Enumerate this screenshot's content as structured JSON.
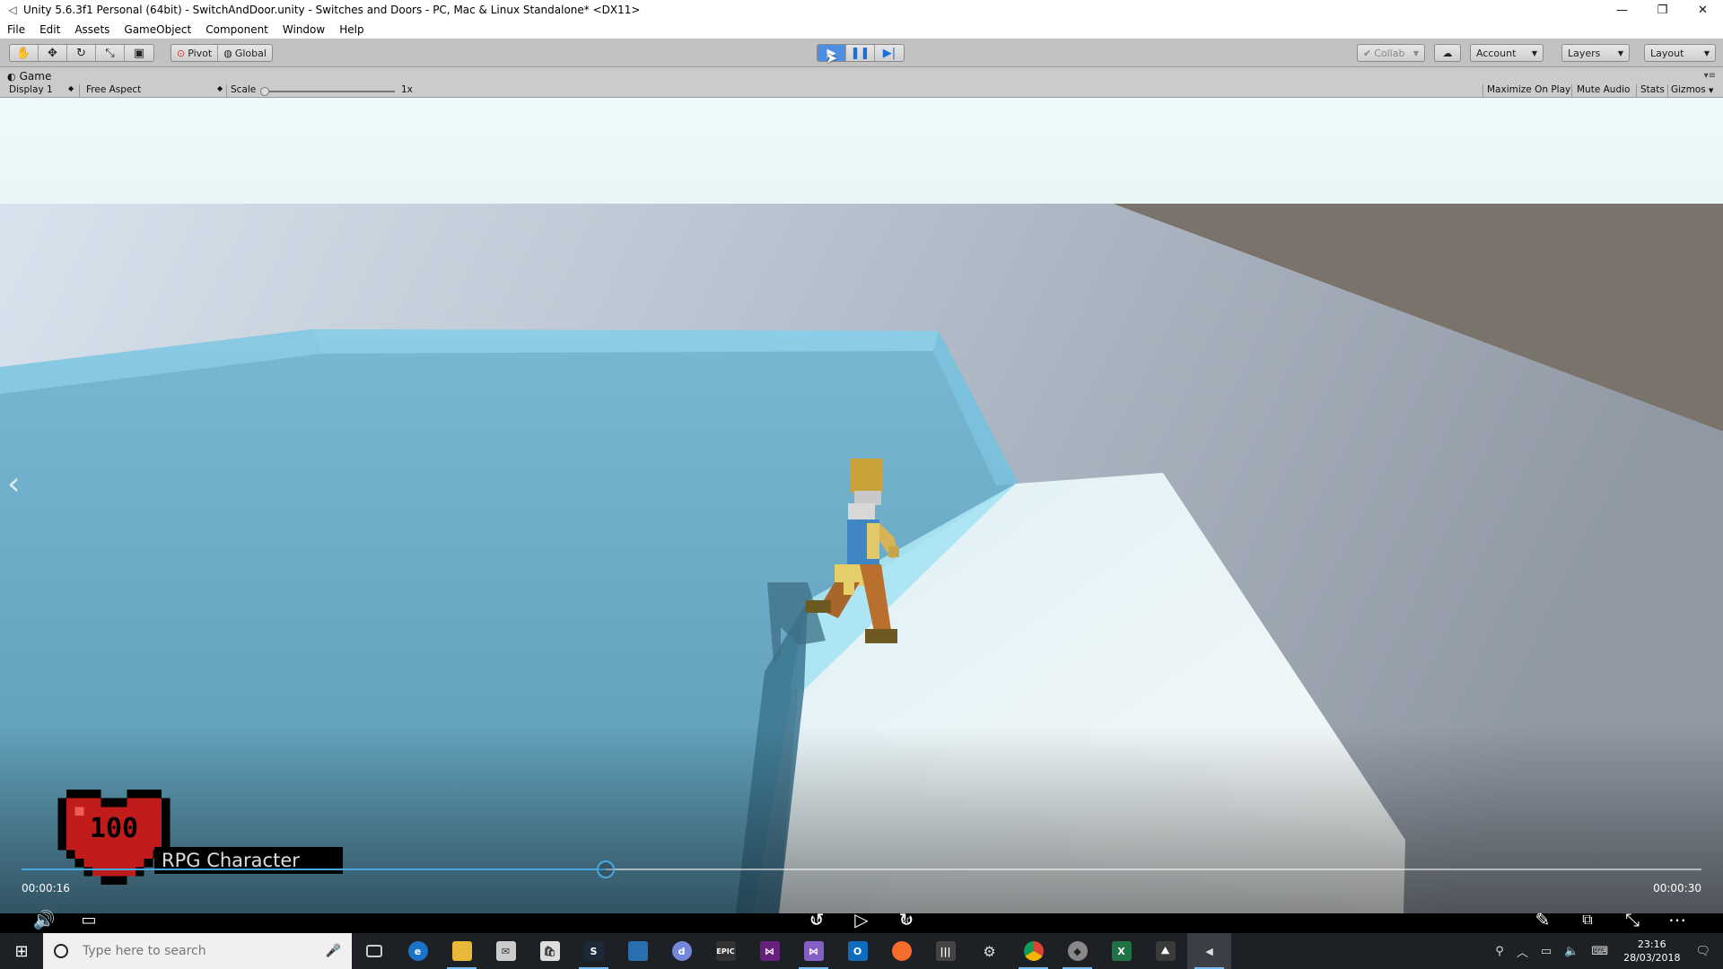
{
  "window": {
    "title": "Unity 5.6.3f1 Personal (64bit) - SwitchAndDoor.unity - Switches and Doors - PC, Mac & Linux Standalone* <DX11>",
    "controls": [
      "—",
      "❐",
      "✕"
    ]
  },
  "menu": [
    "File",
    "Edit",
    "Assets",
    "GameObject",
    "Component",
    "Window",
    "Help"
  ],
  "toolbar": {
    "pivot": "Pivot",
    "global": "Global",
    "collab": "Collab",
    "account": "Account",
    "layers": "Layers",
    "layout": "Layout"
  },
  "game_panel": {
    "tab": "Game",
    "display": "Display 1",
    "aspect": "Free Aspect",
    "scale_label": "Scale",
    "scale_value": "1x",
    "maximize": "Maximize On Play",
    "mute": "Mute Audio",
    "stats": "Stats",
    "gizmos": "Gizmos"
  },
  "hud": {
    "health": "100",
    "character_label": "RPG Character"
  },
  "player": {
    "time_current": "00:00:16",
    "time_total": "00:00:30",
    "progress": 0.348,
    "skip_back": "10",
    "skip_fwd": "30"
  },
  "taskbar": {
    "search_placeholder": "Type here to search",
    "time": "23:16",
    "date": "28/03/2018"
  },
  "colors": {
    "accent": "#4aa8e0",
    "taskbar": "#1d2024",
    "floor_blue": "#63a0bc",
    "floor_white": "#f4f6f7"
  }
}
